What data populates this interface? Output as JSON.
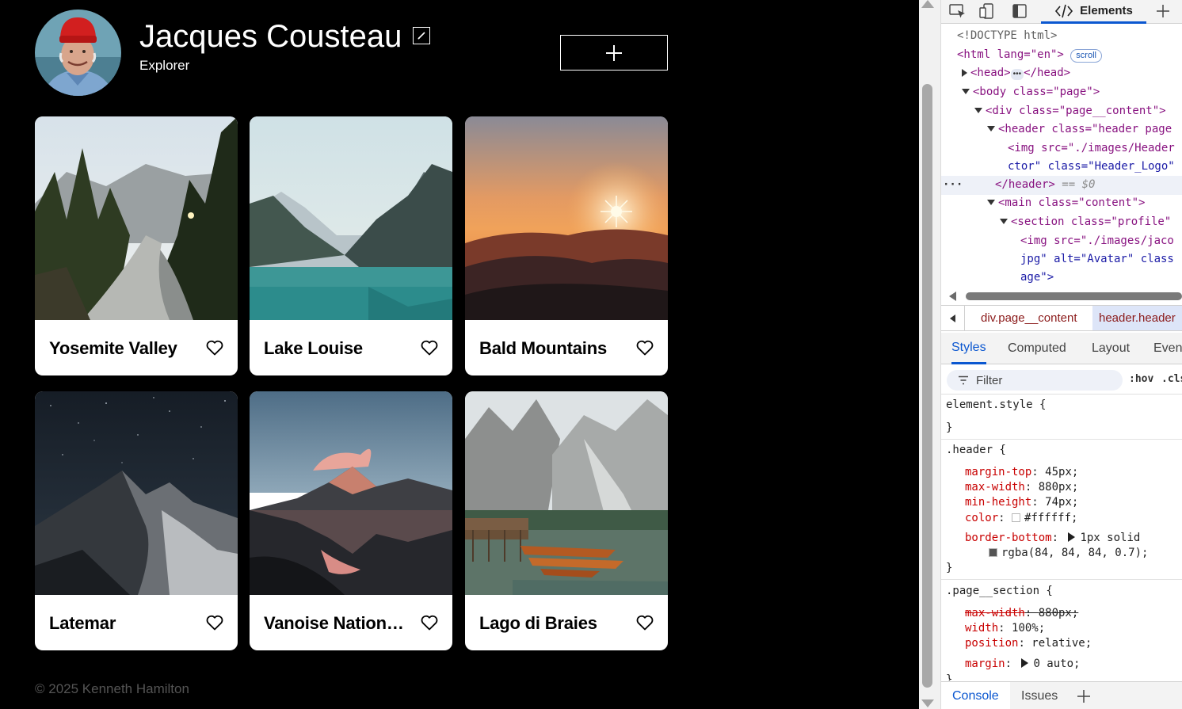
{
  "profile": {
    "name": "Jacques Cousteau",
    "about": "Explorer",
    "avatar_alt": "Avatar"
  },
  "cards": [
    {
      "title": "Yosemite Valley",
      "scene": "forest-river"
    },
    {
      "title": "Lake Louise",
      "scene": "mountain-lake"
    },
    {
      "title": "Bald Mountains",
      "scene": "sunset-hills"
    },
    {
      "title": "Latemar",
      "scene": "night-mountain"
    },
    {
      "title": "Vanoise Nation…",
      "scene": "dusk-reflection"
    },
    {
      "title": "Lago di Braies",
      "scene": "lake-boats"
    }
  ],
  "footer": {
    "text": "© 2025 Kenneth Hamilton"
  },
  "devtools": {
    "active_tab": "Elements",
    "dom": {
      "doctype": "<!DOCTYPE html>",
      "html_open": "<html lang=\"en\">",
      "scroll_badge": "scroll",
      "head": "<head>",
      "head_close": "</head>",
      "body": "<body class=\"page\">",
      "div": "<div class=\"page__content\">",
      "header": "<header class=\"header page",
      "img1a": "<img src=\"./images/Header",
      "img1b": "ctor\" class=\"Header_Logo\"",
      "header_close": "</header>",
      "eq0": "== $0",
      "main": "<main class=\"content\">",
      "section": "<section class=\"profile\"",
      "img2a": "<img src=\"./images/jaco",
      "img2b": "jpg\" alt=\"Avatar\" class",
      "img2c": "age\">"
    },
    "breadcrumbs": [
      "div.page__content",
      "header.header"
    ],
    "subtabs": [
      "Styles",
      "Computed",
      "Layout",
      "Event"
    ],
    "active_subtab": "Styles",
    "filter_placeholder": "Filter",
    "hov": ":hov",
    "cls": ".cls",
    "styles": {
      "element_style": "element.style {",
      "close": "}",
      "header_sel": ".header {",
      "header_props": [
        {
          "prop": "margin-top",
          "val": "45px;"
        },
        {
          "prop": "max-width",
          "val": "880px;"
        },
        {
          "prop": "min-height",
          "val": "74px;"
        },
        {
          "prop": "color",
          "val": "#ffffff;"
        },
        {
          "prop": "border-bottom",
          "val": "1px solid"
        }
      ],
      "border_color_val": "rgba(84, 84, 84, 0.7);",
      "section_sel": ".page__section {",
      "section_props": [
        {
          "prop": "max-width",
          "val": "880px;"
        },
        {
          "prop": "width",
          "val": "100%;"
        },
        {
          "prop": "position",
          "val": "relative;"
        },
        {
          "prop": "margin",
          "val": "0 auto;"
        }
      ]
    },
    "drawer_tabs": [
      "Console",
      "Issues"
    ]
  },
  "colors": {
    "background": "#000000",
    "card": "#ffffff",
    "footer_text": "#545454",
    "devtools_accent": "#0b57d0"
  }
}
